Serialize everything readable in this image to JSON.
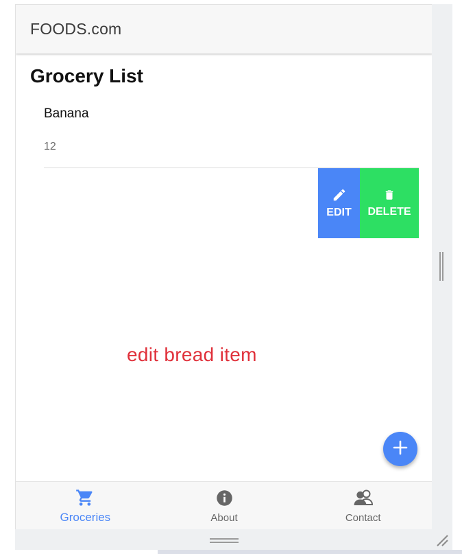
{
  "app": {
    "title": "FOODS.com"
  },
  "page": {
    "title": "Grocery List"
  },
  "list": {
    "items": [
      {
        "name": "Banana",
        "quantity": "12"
      }
    ]
  },
  "item_options": {
    "edit_label": "EDIT",
    "delete_label": "DELETE",
    "edit_icon": "pencil-icon",
    "delete_icon": "trash-icon",
    "edit_color": "#4a86f7",
    "delete_color": "#2ddf63"
  },
  "annotation": {
    "text": "edit bread item",
    "color": "#e0303a"
  },
  "fab": {
    "icon": "add-icon",
    "color": "#4a86f7"
  },
  "tabs": [
    {
      "label": "Groceries",
      "icon": "cart-icon",
      "active": true
    },
    {
      "label": "About",
      "icon": "info-icon",
      "active": false
    },
    {
      "label": "Contact",
      "icon": "people-icon",
      "active": false
    }
  ],
  "colors": {
    "accent": "#4a86f7"
  }
}
